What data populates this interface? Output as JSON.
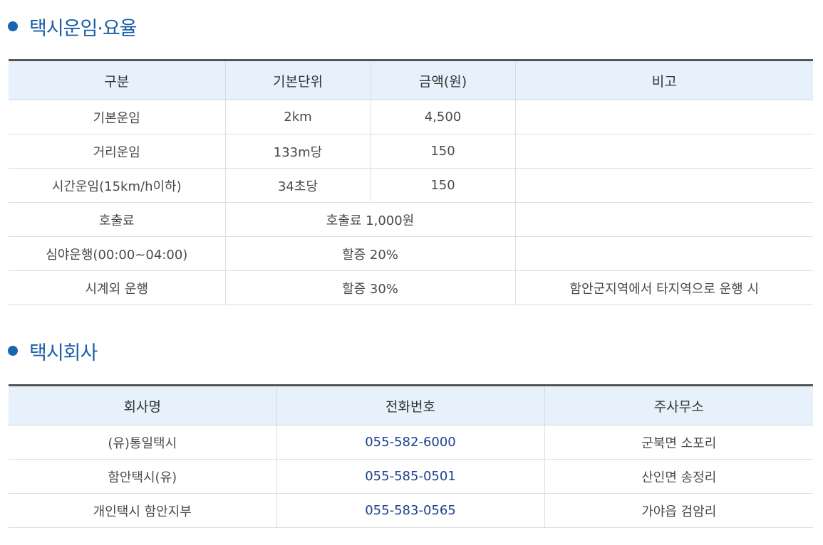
{
  "fare_section": {
    "title": "택시운임·요율",
    "headers": [
      "구분",
      "기본단위",
      "금액(원)",
      "비고"
    ],
    "rows": {
      "base": {
        "category": "기본운임",
        "unit": "2km",
        "amount": "4,500",
        "note": ""
      },
      "distance": {
        "category": "거리운임",
        "unit": "133m당",
        "amount": "150",
        "note": ""
      },
      "time": {
        "category": "시간운임(15km/h이하)",
        "unit": "34초당",
        "amount": "150",
        "note": ""
      },
      "call": {
        "category": "호출료",
        "merged": "호출료 1,000원",
        "note": ""
      },
      "night": {
        "category": "심야운행(00:00~04:00)",
        "merged": "할증 20%",
        "note": ""
      },
      "outside": {
        "category": "시계외 운행",
        "merged": "할증 30%",
        "note": "함안군지역에서 타지역으로 운행 시"
      }
    }
  },
  "company_section": {
    "title": "택시회사",
    "headers": [
      "회사명",
      "전화번호",
      "주사무소"
    ],
    "rows": [
      {
        "name": "(유)통일택시",
        "phone": "055-582-6000",
        "office": "군북면 소포리"
      },
      {
        "name": "함안택시(유)",
        "phone": "055-585-0501",
        "office": "산인면 송정리"
      },
      {
        "name": "개인택시 함안지부",
        "phone": "055-583-0565",
        "office": "가야읍 검암리"
      }
    ]
  },
  "colors": {
    "accent": "#1a65b0",
    "title_text": "#1a5ea8",
    "header_bg": "#e6f1fb",
    "phone_text": "#1c3f8f"
  }
}
